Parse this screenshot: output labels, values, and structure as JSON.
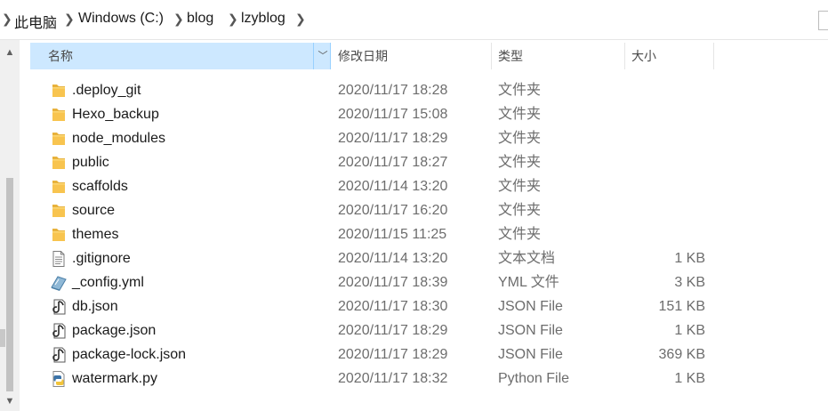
{
  "breadcrumb": {
    "items": [
      "此电脑",
      "Windows (C:)",
      "blog",
      "lzyblog"
    ],
    "separator_icon": "chevron-right-icon"
  },
  "columns": {
    "name": "名称",
    "date": "修改日期",
    "type": "类型",
    "size": "大小"
  },
  "colors": {
    "header_selected_bg": "#cde8ff",
    "folder_yellow": "#f8c44f",
    "text_gray": "#6d6d6d"
  },
  "files": [
    {
      "name": ".deploy_git",
      "date": "2020/11/17 18:28",
      "type": "文件夹",
      "size": "",
      "icon": "folder-icon"
    },
    {
      "name": "Hexo_backup",
      "date": "2020/11/17 15:08",
      "type": "文件夹",
      "size": "",
      "icon": "folder-icon"
    },
    {
      "name": "node_modules",
      "date": "2020/11/17 18:29",
      "type": "文件夹",
      "size": "",
      "icon": "folder-icon"
    },
    {
      "name": "public",
      "date": "2020/11/17 18:27",
      "type": "文件夹",
      "size": "",
      "icon": "folder-icon"
    },
    {
      "name": "scaffolds",
      "date": "2020/11/14 13:20",
      "type": "文件夹",
      "size": "",
      "icon": "folder-icon"
    },
    {
      "name": "source",
      "date": "2020/11/17 16:20",
      "type": "文件夹",
      "size": "",
      "icon": "folder-icon"
    },
    {
      "name": "themes",
      "date": "2020/11/15 11:25",
      "type": "文件夹",
      "size": "",
      "icon": "folder-icon"
    },
    {
      "name": ".gitignore",
      "date": "2020/11/14 13:20",
      "type": "文本文档",
      "size": "1 KB",
      "icon": "text-document-icon"
    },
    {
      "name": "_config.yml",
      "date": "2020/11/17 18:39",
      "type": "YML 文件",
      "size": "3 KB",
      "icon": "yml-file-icon"
    },
    {
      "name": "db.json",
      "date": "2020/11/17 18:30",
      "type": "JSON File",
      "size": "151 KB",
      "icon": "json-file-icon"
    },
    {
      "name": "package.json",
      "date": "2020/11/17 18:29",
      "type": "JSON File",
      "size": "1 KB",
      "icon": "json-file-icon"
    },
    {
      "name": "package-lock.json",
      "date": "2020/11/17 18:29",
      "type": "JSON File",
      "size": "369 KB",
      "icon": "json-file-icon"
    },
    {
      "name": "watermark.py",
      "date": "2020/11/17 18:32",
      "type": "Python File",
      "size": "1 KB",
      "icon": "python-file-icon"
    }
  ]
}
